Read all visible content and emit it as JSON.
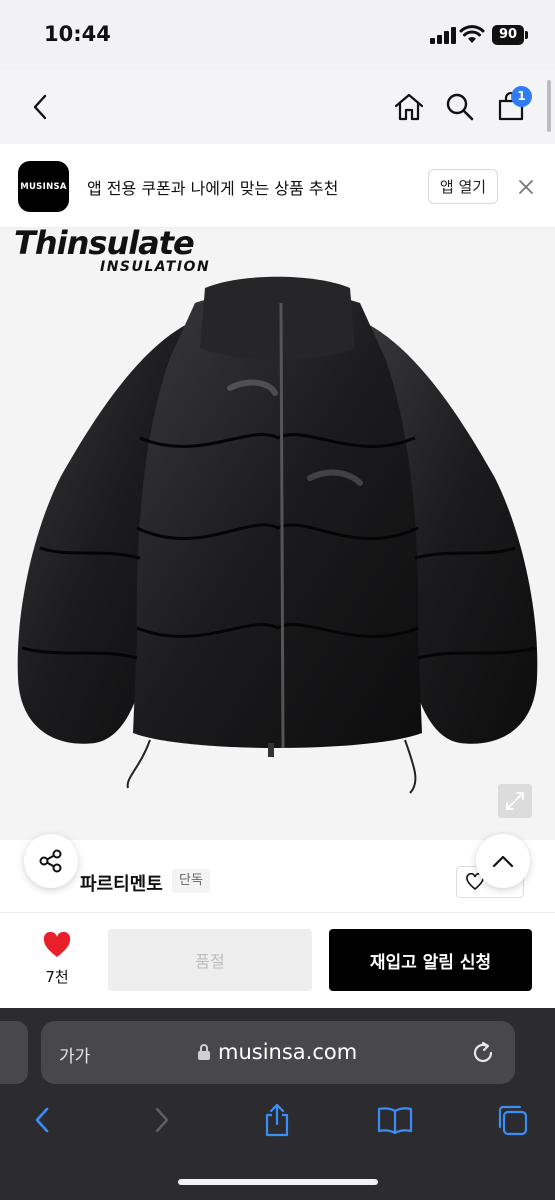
{
  "status_bar": {
    "time": "10:44",
    "battery": "90"
  },
  "nav": {
    "cart_count": "1"
  },
  "app_banner": {
    "logo_text": "MUSINSA",
    "message": "앱 전용 쿠폰과 나에게 맞는 상품 추천",
    "open_label": "앱 열기"
  },
  "product_image": {
    "brand_mark_line1": "Thinsulate",
    "brand_mark_line2": "INSULATION"
  },
  "brand_row": {
    "brand_name": "파르티멘토",
    "exclusive_badge": "단독"
  },
  "purchase": {
    "like_count": "7천",
    "soldout_label": "품절",
    "restock_label": "재입고 알림 신청"
  },
  "browser": {
    "text_size_label": "가가",
    "url": "musinsa.com"
  },
  "colors": {
    "accent_blue": "#2f7cf6",
    "heart_red": "#e8202a",
    "restock_black": "#000000"
  }
}
